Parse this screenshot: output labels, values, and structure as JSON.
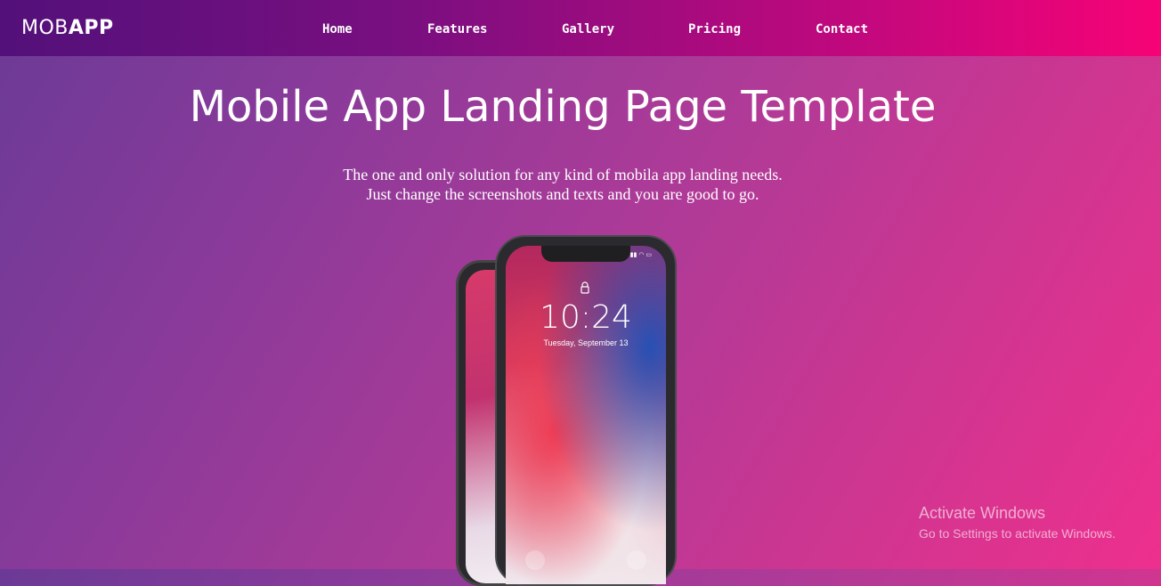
{
  "navbar": {
    "logo_light": "MOB",
    "logo_bold": "APP",
    "links": [
      "Home",
      "Features",
      "Gallery",
      "Pricing",
      "Contact"
    ]
  },
  "hero": {
    "title": "Mobile App Landing Page Template",
    "subtitle_line1": "The one and only solution for any kind of mobila app landing needs.",
    "subtitle_line2": "Just change the screenshots and texts and you are good to go."
  },
  "phone": {
    "time": "10:24",
    "date": "Tuesday, September 13",
    "icons": [
      "lock-icon",
      "flashlight-icon",
      "camera-icon"
    ]
  },
  "watermark": {
    "title": "Activate Windows",
    "subtitle": "Go to Settings to activate Windows."
  },
  "colors": {
    "nav_start": "#53107a",
    "nav_end": "#f60376",
    "bg_start": "#6b3a96",
    "bg_end": "#ee2f8e"
  }
}
